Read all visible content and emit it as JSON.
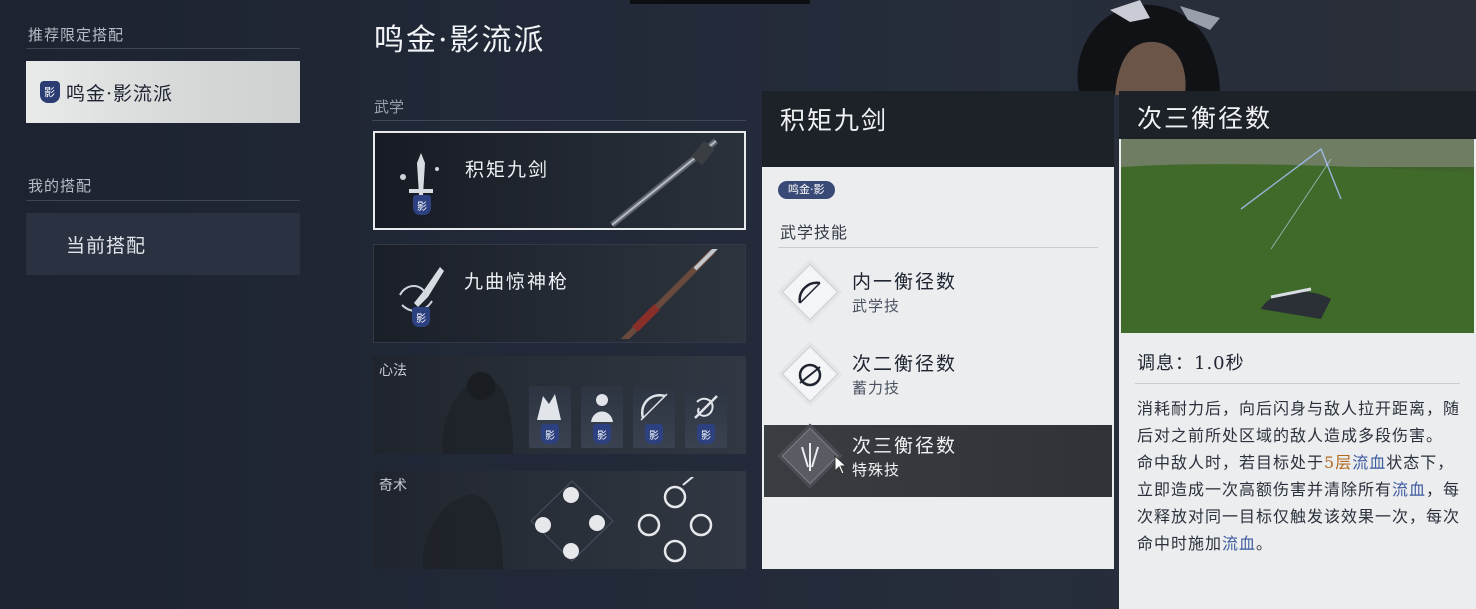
{
  "left": {
    "recommended_heading": "推荐限定搭配",
    "recommended_item": {
      "seal": "影",
      "label": "鸣金·影流派"
    },
    "mine_heading": "我的搭配",
    "mine_item": {
      "label": "当前搭配"
    }
  },
  "middle": {
    "build_title": "鸣金·影流派",
    "martial_label": "武学",
    "weapons": [
      {
        "name": "积矩九剑",
        "seal": "影"
      },
      {
        "name": "九曲惊神枪",
        "seal": "影"
      }
    ],
    "heart_label": "心法",
    "heart_seals": [
      "影",
      "影",
      "影",
      "影"
    ],
    "arts_label": "奇术"
  },
  "skills": {
    "title": "积矩九剑",
    "tag": "鸣金·影",
    "subtitle": "武学技能",
    "items": [
      {
        "name": "内一衡径数",
        "type": "武学技"
      },
      {
        "name": "次二衡径数",
        "type": "蓄力技"
      },
      {
        "name": "次三衡径数",
        "type": "特殊技"
      }
    ]
  },
  "detail": {
    "title": "次三衡径数",
    "cooldown": "调息：1.0秒",
    "desc_1": "消耗耐力后，向后闪身与敌人拉开距离，随后对之前所处区域的敌人造成多段伤害。",
    "desc_2a": "命中敌人时，若目标处于",
    "desc_2_num": "5层",
    "desc_2_bleed": "流血",
    "desc_2b": "状态下，立即造成一次高额伤害并清除所有",
    "desc_2_bleed2": "流血",
    "desc_2c": "，每次释放对同一目标仅触发该效果一次，每次命中时施加",
    "desc_2_bleed3": "流血",
    "desc_2d": "。"
  },
  "colors": {
    "accent_seal": "#2b3d73",
    "highlight_number": "#b26a22",
    "highlight_keyword": "#3c5a9e"
  }
}
